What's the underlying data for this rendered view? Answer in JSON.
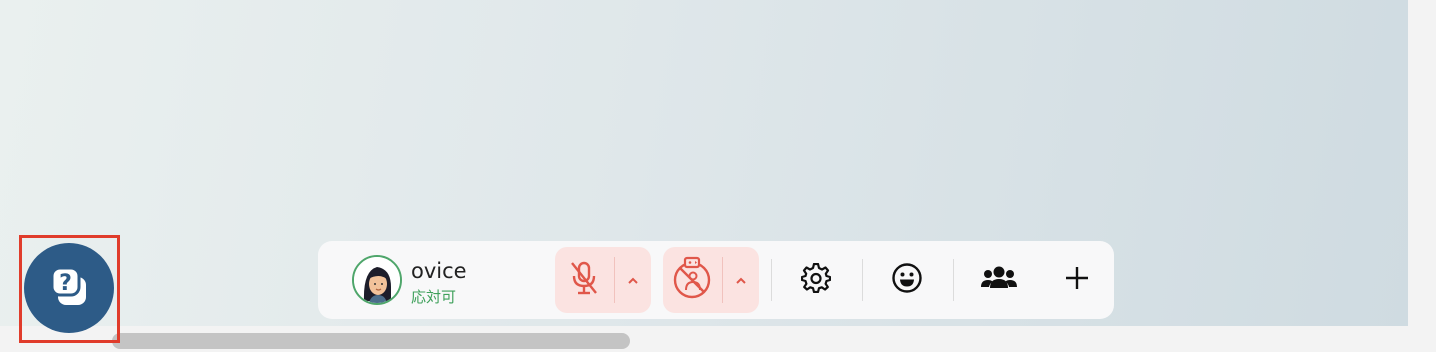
{
  "user": {
    "name": "ovice",
    "status": "応対可"
  },
  "toolbar": {
    "mic": {
      "icon": "microphone-off-icon",
      "state": "muted"
    },
    "camera": {
      "icon": "camera-off-icon",
      "state": "off"
    },
    "settings": {
      "icon": "gear-icon"
    },
    "reaction": {
      "icon": "smile-icon"
    },
    "members": {
      "icon": "users-icon"
    },
    "add": {
      "icon": "plus-icon"
    }
  },
  "help_button": {
    "icon": "help-chat-icon"
  },
  "colors": {
    "accent_red": "#e0574a",
    "status_green": "#3ea05a",
    "help_blue": "#2d5b87",
    "highlight": "#e03c2b"
  }
}
